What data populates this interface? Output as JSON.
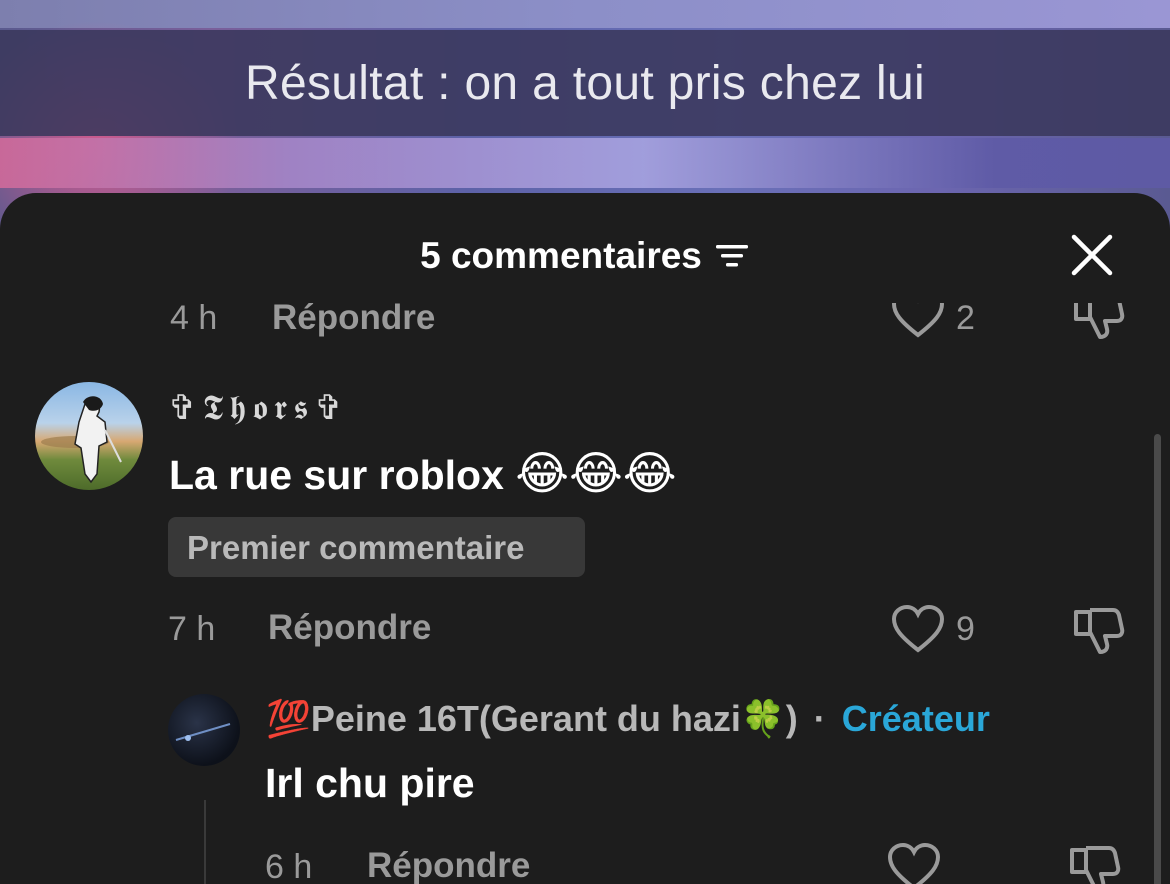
{
  "video": {
    "subtitle": "Résultat : on a tout pris chez lui"
  },
  "sheet": {
    "title": "5 commentaires",
    "sort_icon": "filter-lines-icon",
    "close_icon": "close-icon"
  },
  "comments": [
    {
      "time": "4 h",
      "reply_label": "Répondre",
      "likes": "2"
    },
    {
      "username": "✞𝕿𝖍𝖔𝖗𝖘✞",
      "text": "La rue sur roblox",
      "emojis": "😂😂😂",
      "badge": "Premier commentaire",
      "time": "7 h",
      "reply_label": "Répondre",
      "likes": "9"
    }
  ],
  "reply": {
    "username": "💯Peine 16T(Gerant du hazi🍀)",
    "separator": "·",
    "creator_label": "Créateur",
    "text": "Irl chu pire",
    "time": "6 h",
    "reply_label": "Répondre"
  },
  "colors": {
    "accent": "#2aa7d8",
    "background": "#1d1d1d",
    "badge_bg": "#383838"
  }
}
